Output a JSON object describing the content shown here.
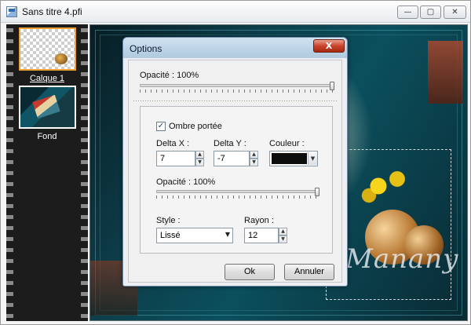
{
  "window": {
    "title": "Sans titre 4.pfi",
    "icon": "app-document-icon",
    "controls": {
      "minimize": "—",
      "maximize": "▢",
      "close": "✕"
    }
  },
  "layers": [
    {
      "name": "Calque 1",
      "selected": true
    },
    {
      "name": "Fond",
      "selected": false
    }
  ],
  "canvas": {
    "watermark": "Manany"
  },
  "dialog": {
    "title": "Options",
    "close_glyph": "X",
    "opacity_top": {
      "label": "Opacité : 100%",
      "value": 100
    },
    "shadow": {
      "checkbox_label": "Ombre portée",
      "checked": true,
      "check_glyph": "✓",
      "delta_x": {
        "label": "Delta X :",
        "value": "7"
      },
      "delta_y": {
        "label": "Delta Y :",
        "value": "-7"
      },
      "color": {
        "label": "Couleur :",
        "value": "#0d0d0d"
      },
      "opacity": {
        "label": "Opacité : 100%",
        "value": 100
      },
      "style": {
        "label": "Style :",
        "value": "Lissé"
      },
      "radius": {
        "label": "Rayon :",
        "value": "12"
      }
    },
    "buttons": {
      "ok": "Ok",
      "cancel": "Annuler"
    },
    "spin_up": "▲",
    "spin_down": "▼",
    "dropdown_arrow": "▼"
  }
}
